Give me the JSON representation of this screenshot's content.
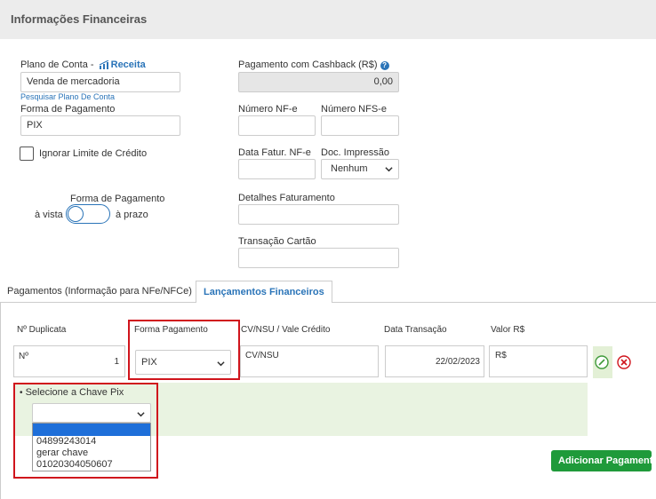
{
  "header": {
    "title": "Informações Financeiras"
  },
  "plano": {
    "label": "Plano de Conta - ",
    "type_label": "Receita",
    "value": "Venda de mercadoria",
    "link": "Pesquisar Plano De Conta"
  },
  "forma_pagamento": {
    "label": "Forma de Pagamento",
    "value": "PIX"
  },
  "credit_limit": {
    "label": "Ignorar Limite de Crédito",
    "checked": false
  },
  "payment_toggle": {
    "title": "Forma de Pagamento",
    "left": "à vista",
    "right": "à prazo"
  },
  "cashback": {
    "label": "Pagamento com Cashback (R$)",
    "help_icon": "question-icon",
    "value": "0,00"
  },
  "nfe": {
    "label": "Número NF-e",
    "value": ""
  },
  "nfse": {
    "label": "Número NFS-e",
    "value": ""
  },
  "data_fatur": {
    "label": "Data Fatur. NF-e",
    "value": ""
  },
  "doc_impressao": {
    "label": "Doc. Impressão",
    "value": "Nenhum"
  },
  "detalhes": {
    "label": "Detalhes Faturamento",
    "value": ""
  },
  "transacao": {
    "label": "Transação Cartão",
    "value": ""
  },
  "tabs": [
    {
      "label": "Pagamentos (Informação para NFe/NFCe)",
      "active": true
    },
    {
      "label": "Lançamentos Financeiros",
      "active": false
    }
  ],
  "grid": {
    "columns": [
      "Nº Duplicata",
      "Forma Pagamento",
      "CV/NSU / Vale Crédito",
      "Data Transação",
      "Valor R$"
    ],
    "row": {
      "duplicata_prefix": "Nº",
      "duplicata_num": "1",
      "forma": "PIX",
      "cvnsu": "CV/NSU",
      "data": "22/02/2023",
      "valor": "R$"
    }
  },
  "pix": {
    "label": "Selecione a Chave Pix",
    "selected": "",
    "options": [
      "",
      "04899243014",
      "gerar chave",
      "01020304050607"
    ]
  },
  "add_payment": {
    "label": "Adicionar Pagamento"
  },
  "colors": {
    "accent": "#2a74b8",
    "highlight": "#d0141c",
    "green": "#1f9a3a"
  }
}
